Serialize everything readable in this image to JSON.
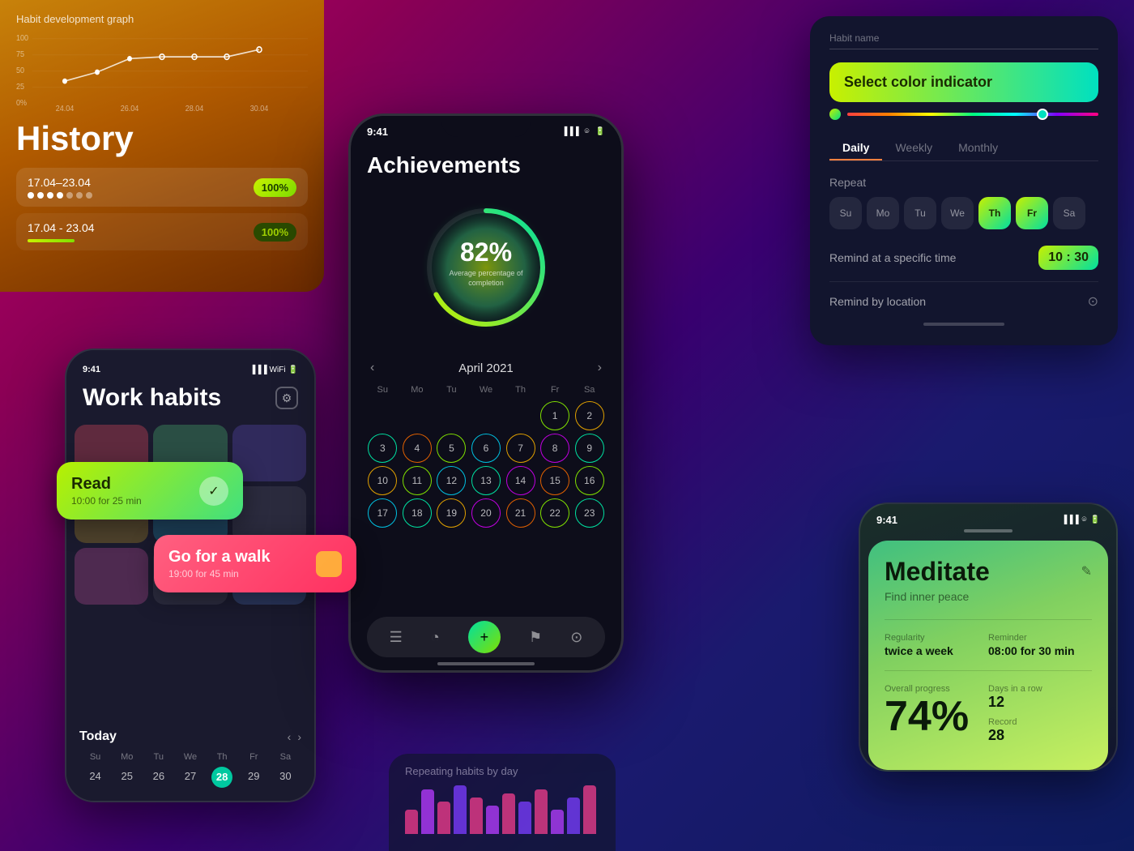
{
  "history": {
    "title": "History",
    "graph_title": "Habit development graph",
    "row1": {
      "date": "17.04–23.04",
      "badge": "100%"
    },
    "row2": {
      "date": "17.04 - 23.04",
      "badge": "100%"
    },
    "y_labels": [
      "100",
      "75",
      "50",
      "25",
      "0%"
    ],
    "x_labels": [
      "24.04",
      "26.04",
      "28.04",
      "30.04"
    ]
  },
  "work_habits": {
    "title": "Work habits",
    "time": "9:41",
    "today_label": "Today",
    "days_header": [
      "Su",
      "Mo",
      "Tu",
      "We",
      "Th",
      "Fr",
      "Sa"
    ],
    "day_numbers": [
      "24",
      "25",
      "26",
      "27",
      "28",
      "29",
      "30"
    ],
    "today_day": "28"
  },
  "read_card": {
    "title": "Read",
    "subtitle": "10:00 for 25 min",
    "check": "✓"
  },
  "walk_card": {
    "title": "Go for a walk",
    "subtitle": "19:00 for 45 min"
  },
  "achievements": {
    "title": "Achievements",
    "time": "9:41",
    "percentage": "82%",
    "percentage_label": "Average percentage of\ncompletion",
    "month": "April 2021",
    "days_header": [
      "Su",
      "Mo",
      "Tu",
      "We",
      "Th",
      "Fr",
      "Sa"
    ],
    "calendar": [
      [
        "",
        "",
        "",
        "",
        "1",
        "2"
      ],
      [
        "3",
        "4",
        "5",
        "6",
        "7",
        "8",
        "9"
      ],
      [
        "10",
        "11",
        "12",
        "13",
        "14",
        "15",
        "16"
      ],
      [
        "17",
        "18",
        "19",
        "20",
        "21",
        "22",
        "23"
      ]
    ]
  },
  "settings": {
    "habit_name_placeholder": "Habit name",
    "color_indicator_label": "Select color indicator",
    "tabs": [
      "Daily",
      "Weekly",
      "Monthly"
    ],
    "active_tab": "Daily",
    "repeat_label": "Repeat",
    "days": [
      "Su",
      "Mo",
      "Tu",
      "We",
      "Th",
      "Fr",
      "Sa"
    ],
    "active_days": [
      "Th",
      "Fr"
    ],
    "remind_time_label": "Remind at a specific time",
    "time_value": "10 : 30",
    "remind_location_label": "Remind by location"
  },
  "meditate": {
    "time": "9:41",
    "title": "Meditate",
    "subtitle": "Find inner peace",
    "edit_icon": "✎",
    "regularity_label": "Regularity",
    "regularity_value": "twice a week",
    "reminder_label": "Reminder",
    "reminder_value": "08:00 for 30 min",
    "progress_label": "Overall progress",
    "progress_value": "74%",
    "days_label": "Days in a row",
    "days_value": "12",
    "record_label": "Record",
    "record_value": "28"
  },
  "repeating": {
    "title": "Repeating habits by day",
    "bars": [
      30,
      55,
      40,
      60,
      45,
      35,
      50,
      40,
      55,
      30,
      45,
      60
    ],
    "bar_colors": [
      "#ff4080",
      "#c040ff",
      "#ff4080",
      "#8040ff",
      "#ff4080",
      "#c040ff",
      "#ff4080",
      "#8040ff",
      "#ff4080",
      "#c040ff",
      "#8040ff",
      "#ff4080"
    ]
  },
  "icons": {
    "arrow_left": "‹",
    "arrow_right": "›",
    "gear": "⚙",
    "location_pin": "⊙",
    "edit": "✎",
    "check": "✓",
    "list_icon": "☰",
    "pie_icon": "◔",
    "plus_icon": "+",
    "flag_icon": "⚑",
    "person_icon": "⊙"
  }
}
